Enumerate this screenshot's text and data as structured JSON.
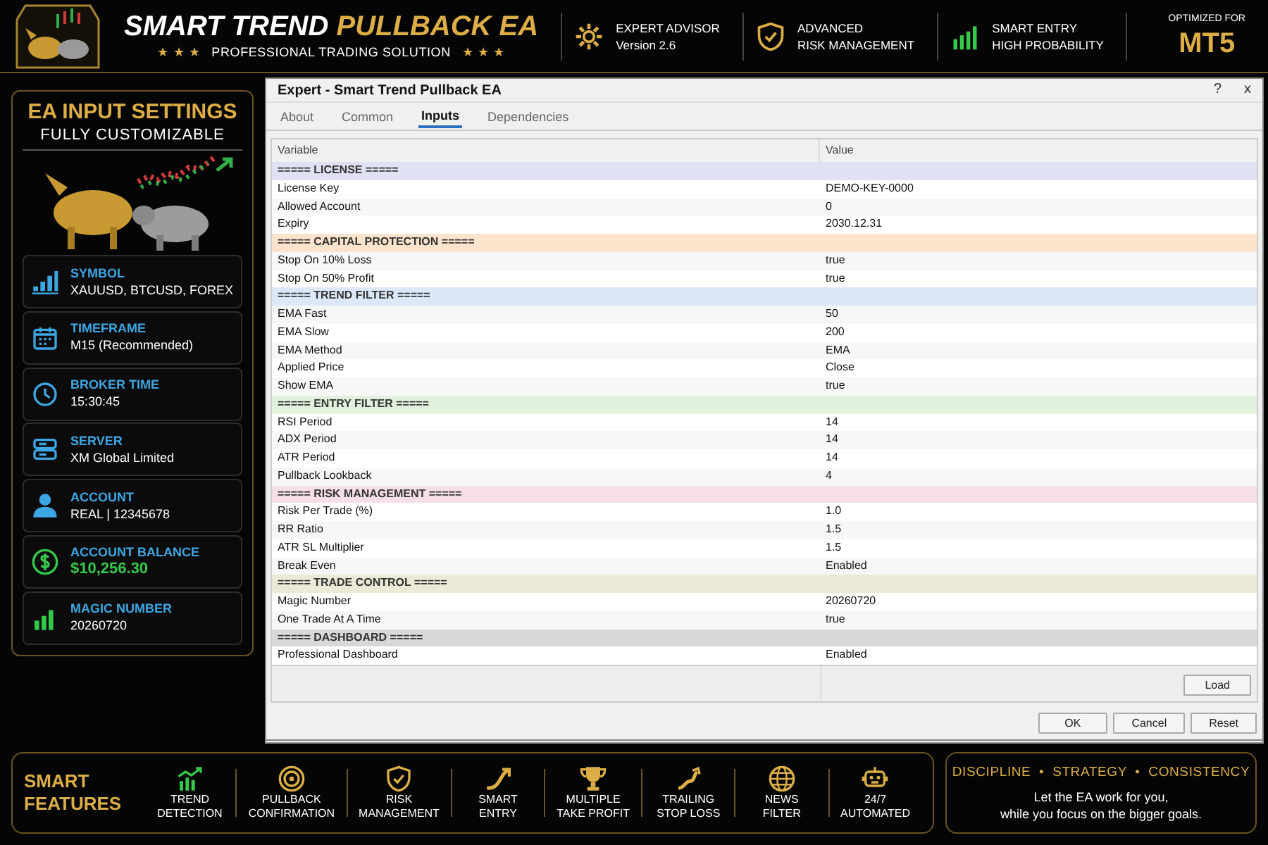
{
  "header": {
    "title_main": "SMART TREND",
    "title_accent": "PULLBACK EA",
    "stars_left": "★ ★ ★",
    "subtitle": "PROFESSIONAL TRADING SOLUTION",
    "stars_right": "★ ★ ★",
    "badges": [
      {
        "kind": "gear",
        "title": "EXPERT ADVISOR",
        "subtitle": "Version 2.6"
      },
      {
        "kind": "shield",
        "title": "ADVANCED",
        "subtitle": "RISK MANAGEMENT"
      },
      {
        "kind": "chart",
        "title": "SMART ENTRY",
        "subtitle": "HIGH PROBABILITY"
      }
    ],
    "optimized": {
      "label": "OPTIMIZED FOR",
      "value": "MT5"
    }
  },
  "settings_panel": {
    "title": "EA INPUT SETTINGS",
    "subtitle": "FULLY CUSTOMIZABLE",
    "items": [
      {
        "kind": "symbol",
        "label": "SYMBOL",
        "value": "XAUUSD, BTCUSD, FOREX"
      },
      {
        "kind": "timeframe",
        "label": "TIMEFRAME",
        "value": "M15 (Recommended)"
      },
      {
        "kind": "clock",
        "label": "BROKER TIME",
        "value": "15:30:45"
      },
      {
        "kind": "server",
        "label": "SERVER",
        "value": "XM Global Limited"
      },
      {
        "kind": "account",
        "label": "ACCOUNT",
        "value": "REAL | 12345678"
      },
      {
        "kind": "balance",
        "label": "ACCOUNT BALANCE",
        "value": "$10,256.30"
      },
      {
        "kind": "magic",
        "label": "MAGIC NUMBER",
        "value": "20260720"
      }
    ]
  },
  "dialog": {
    "title": "Expert - Smart Trend Pullback EA",
    "help": "?",
    "close": "x",
    "tabs": [
      {
        "label": "About",
        "selected": false
      },
      {
        "label": "Common",
        "selected": false
      },
      {
        "label": "Inputs",
        "selected": true
      },
      {
        "label": "Dependencies",
        "selected": false
      }
    ],
    "columns": [
      "Variable",
      "Value"
    ],
    "groups": [
      {
        "title": "===== LICENSE =====",
        "color": "#e1e1f4",
        "rows": [
          {
            "variable": "License Key",
            "value": "DEMO-KEY-0000"
          },
          {
            "variable": "Allowed Account",
            "value": "0"
          },
          {
            "variable": "Expiry",
            "value": "2030.12.31"
          }
        ]
      },
      {
        "title": "===== CAPITAL PROTECTION =====",
        "color": "#fbe4cb",
        "rows": [
          {
            "variable": "Stop On 10% Loss",
            "value": "true"
          },
          {
            "variable": "Stop On 50% Profit",
            "value": "true"
          }
        ]
      },
      {
        "title": "===== TREND FILTER =====",
        "color": "#dce8f8",
        "rows": [
          {
            "variable": "EMA Fast",
            "value": "50"
          },
          {
            "variable": "EMA Slow",
            "value": "200"
          },
          {
            "variable": "EMA Method",
            "value": "EMA"
          },
          {
            "variable": "Applied Price",
            "value": "Close"
          },
          {
            "variable": "Show EMA",
            "value": "true"
          }
        ]
      },
      {
        "title": "===== ENTRY FILTER =====",
        "color": "#e0f2dc",
        "rows": [
          {
            "variable": "RSI Period",
            "value": "14"
          },
          {
            "variable": "ADX Period",
            "value": "14"
          },
          {
            "variable": "ATR Period",
            "value": "14"
          },
          {
            "variable": "Pullback Lookback",
            "value": "4"
          }
        ]
      },
      {
        "title": "===== RISK MANAGEMENT =====",
        "color": "#f6dfe7",
        "rows": [
          {
            "variable": "Risk Per Trade (%)",
            "value": "1.0"
          },
          {
            "variable": "RR Ratio",
            "value": "1.5"
          },
          {
            "variable": "ATR SL Multiplier",
            "value": "1.5"
          },
          {
            "variable": "Break Even",
            "value": "Enabled"
          }
        ]
      },
      {
        "title": "===== TRADE CONTROL =====",
        "color": "#eaead6",
        "rows": [
          {
            "variable": "Magic Number",
            "value": "20260720"
          },
          {
            "variable": "One Trade At A Time",
            "value": "true"
          }
        ]
      },
      {
        "title": "===== DASHBOARD =====",
        "color": "#d8d8d8",
        "rows": [
          {
            "variable": "Professional Dashboard",
            "value": "Enabled"
          }
        ]
      }
    ],
    "side_buttons": [
      "Load"
    ],
    "buttons": [
      "OK",
      "Cancel",
      "Reset"
    ]
  },
  "footer": {
    "title_lines": [
      "SMART",
      "FEATURES"
    ],
    "features": [
      {
        "kind": "trend",
        "lines": [
          "TREND",
          "DETECTION"
        ]
      },
      {
        "kind": "target",
        "lines": [
          "PULLBACK",
          "CONFIRMATION"
        ]
      },
      {
        "kind": "shield",
        "lines": [
          "RISK",
          "MANAGEMENT"
        ]
      },
      {
        "kind": "arrow",
        "lines": [
          "SMART",
          "ENTRY"
        ]
      },
      {
        "kind": "trophy",
        "lines": [
          "MULTIPLE",
          "TAKE PROFIT"
        ]
      },
      {
        "kind": "trail",
        "lines": [
          "TRAILING",
          "STOP LOSS"
        ]
      },
      {
        "kind": "globe",
        "lines": [
          "NEWS",
          "FILTER"
        ]
      },
      {
        "kind": "robot",
        "lines": [
          "24/7",
          "AUTOMATED"
        ]
      }
    ],
    "tagline": {
      "headline": "DISCIPLINE  •  STRATEGY  •  CONSISTENCY",
      "lines": [
        "Let the EA work for you,",
        "while you focus on the bigger goals."
      ]
    }
  }
}
